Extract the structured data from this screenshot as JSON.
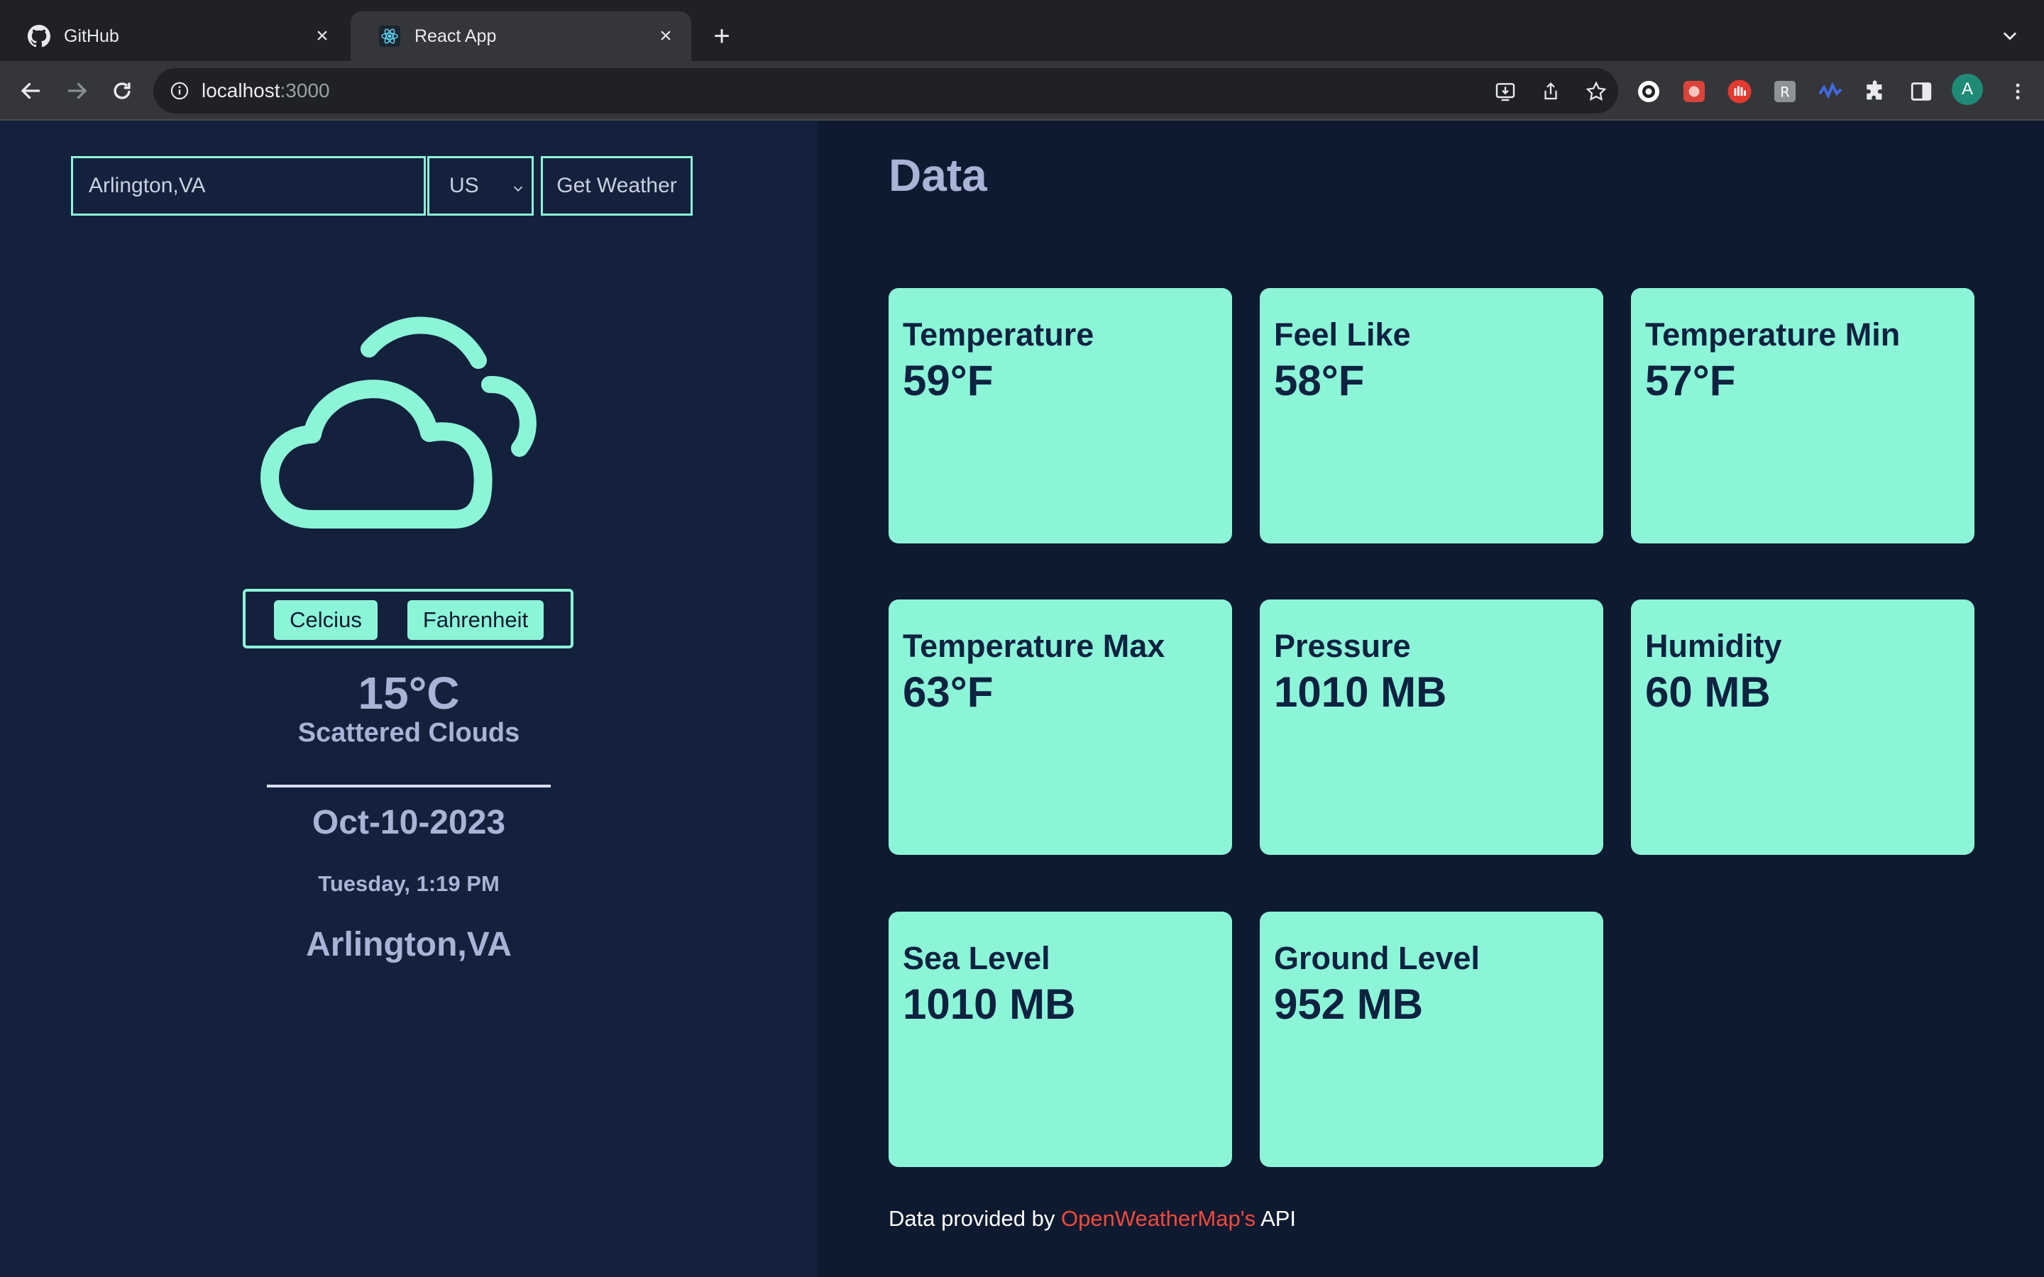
{
  "browser": {
    "tabs": [
      {
        "title": "GitHub",
        "icon": "github-icon"
      },
      {
        "title": "React App",
        "icon": "react-icon"
      }
    ],
    "url_host": "localhost",
    "url_port": ":3000",
    "avatar_letter": "A"
  },
  "search": {
    "city_value": "Arlington,VA",
    "country_value": "US",
    "button_label": "Get Weather"
  },
  "current": {
    "icon": "scattered-clouds-icon",
    "unit_celsius": "Celcius",
    "unit_fahrenheit": "Fahrenheit",
    "temperature": "15°C",
    "description": "Scattered Clouds",
    "date": "Oct-10-2023",
    "time": "Tuesday, 1:19 PM",
    "city": "Arlington,VA"
  },
  "data_panel": {
    "title": "Data",
    "cards": [
      {
        "label": "Temperature",
        "value": "59°F"
      },
      {
        "label": "Feel Like",
        "value": "58°F"
      },
      {
        "label": "Temperature Min",
        "value": "57°F"
      },
      {
        "label": "Temperature Max",
        "value": "63°F"
      },
      {
        "label": "Pressure",
        "value": "1010 MB"
      },
      {
        "label": "Humidity",
        "value": "60 MB"
      },
      {
        "label": "Sea Level",
        "value": "1010 MB"
      },
      {
        "label": "Ground Level",
        "value": "952 MB"
      }
    ]
  },
  "footer": {
    "prefix": "Data provided by",
    "link": "OpenWeatherMap's",
    "suffix": "API"
  },
  "colors": {
    "accent": "#8cf5d8",
    "left_bg": "#14213d",
    "right_bg": "#0e1a30",
    "link": "#f24b3b"
  }
}
